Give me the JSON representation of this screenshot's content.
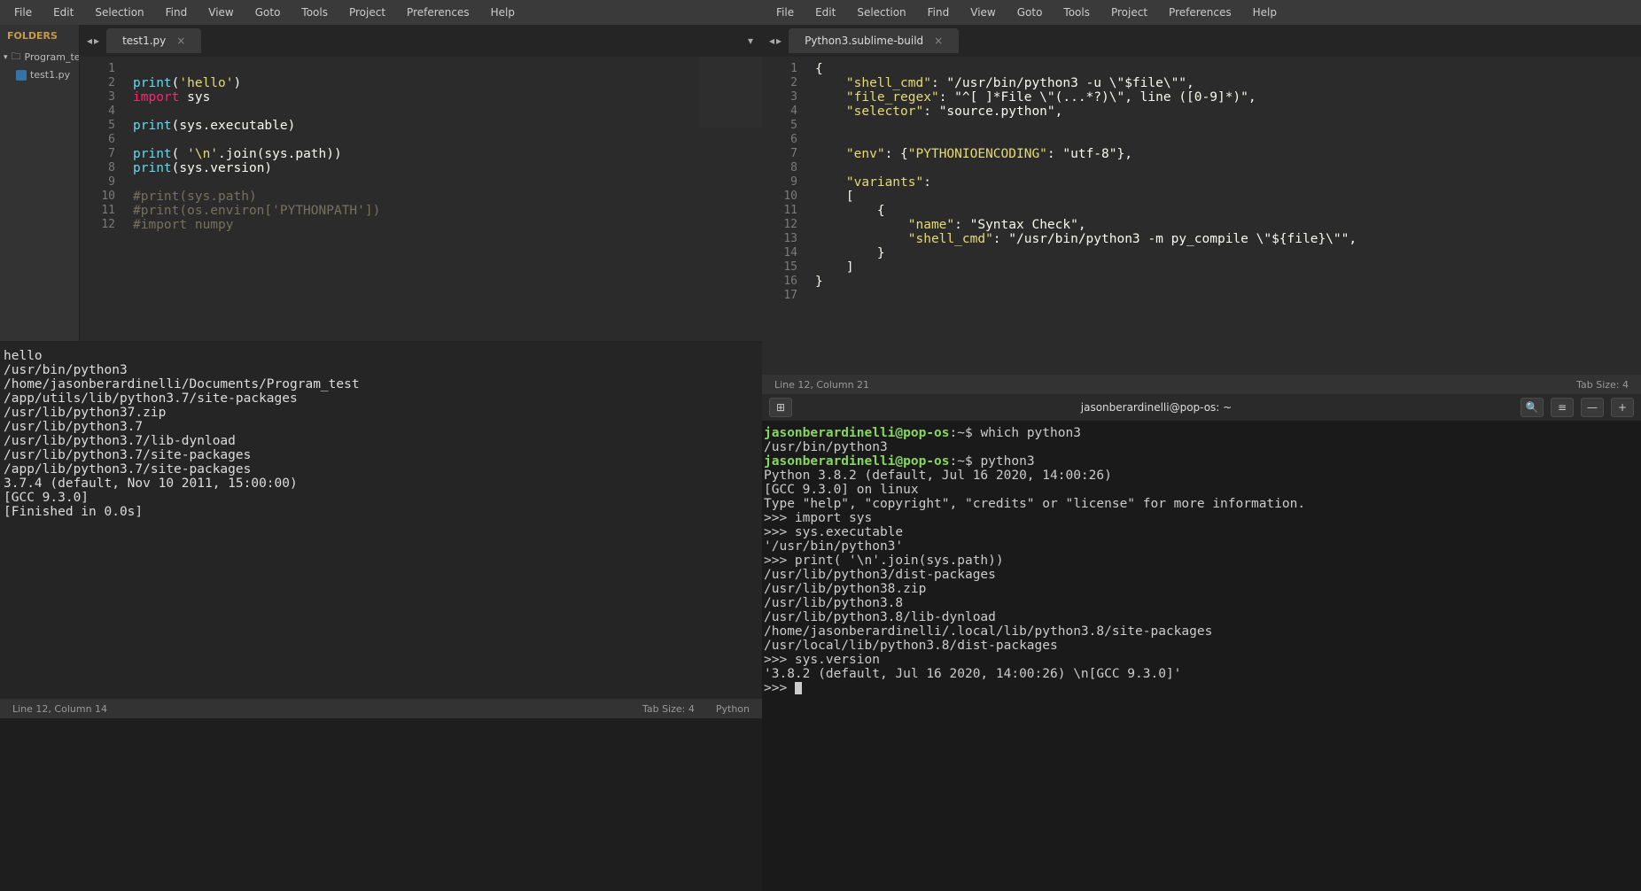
{
  "left": {
    "menubar": [
      "File",
      "Edit",
      "Selection",
      "Find",
      "View",
      "Goto",
      "Tools",
      "Project",
      "Preferences",
      "Help"
    ],
    "sidebar": {
      "title": "FOLDERS",
      "folder": "Program_tes",
      "file": "test1.py"
    },
    "tab": {
      "name": "test1.py"
    },
    "code": {
      "l1": "",
      "l2_fn": "print",
      "l2_p1": "(",
      "l2_str": "'hello'",
      "l2_p2": ")",
      "l3_kw": "import",
      "l3_id": " sys",
      "l4": "",
      "l5_fn": "print",
      "l5_p1": "(",
      "l5_id": "sys.executable",
      "l5_p2": ")",
      "l6": "",
      "l7_fn": "print",
      "l7_p1": "( ",
      "l7_str": "'\\n'",
      "l7_id": ".join(sys.path))",
      "l8_fn": "print",
      "l8_p1": "(",
      "l8_id": "sys.version",
      "l8_p2": ")",
      "l9": "",
      "l10_c": "#print(sys.path)",
      "l11_c": "#print(os.environ['PYTHONPATH'])",
      "l12_c": "#import numpy"
    },
    "build_output": "hello\n/usr/bin/python3\n/home/jasonberardinelli/Documents/Program_test\n/app/utils/lib/python3.7/site-packages\n/usr/lib/python37.zip\n/usr/lib/python3.7\n/usr/lib/python3.7/lib-dynload\n/usr/lib/python3.7/site-packages\n/app/lib/python3.7/site-packages\n3.7.4 (default, Nov 10 2011, 15:00:00) \n[GCC 9.3.0]\n[Finished in 0.0s]",
    "status": {
      "pos": "Line 12, Column 14",
      "tabsize": "Tab Size: 4",
      "syntax": "Python"
    }
  },
  "right": {
    "menubar": [
      "File",
      "Edit",
      "Selection",
      "Find",
      "View",
      "Goto",
      "Tools",
      "Project",
      "Preferences",
      "Help"
    ],
    "tab": {
      "name": "Python3.sublime-build"
    },
    "code_lines": [
      "{",
      "    \"shell_cmd\": \"/usr/bin/python3 -u \\\"$file\\\"\",",
      "    \"file_regex\": \"^[ ]*File \\\"(...*?)\\\", line ([0-9]*)\",",
      "    \"selector\": \"source.python\",",
      "",
      "",
      "    \"env\": {\"PYTHONIOENCODING\": \"utf-8\"},",
      "",
      "    \"variants\":",
      "    [",
      "        {",
      "            \"name\": \"Syntax Check\",",
      "            \"shell_cmd\": \"/usr/bin/python3 -m py_compile \\\"${file}\\\"\",",
      "        }",
      "    ]",
      "}",
      ""
    ],
    "status": {
      "pos": "Line 12, Column 21",
      "tabsize": "Tab Size: 4"
    }
  },
  "terminal": {
    "title": "jasonberardinelli@pop-os: ~",
    "prompt_user": "jasonberardinelli@pop-os",
    "prompt_path": ":~$ ",
    "lines": [
      {
        "type": "cmd",
        "text": "which python3"
      },
      {
        "type": "out",
        "text": "/usr/bin/python3"
      },
      {
        "type": "cmd",
        "text": "python3"
      },
      {
        "type": "out",
        "text": "Python 3.8.2 (default, Jul 16 2020, 14:00:26) "
      },
      {
        "type": "out",
        "text": "[GCC 9.3.0] on linux"
      },
      {
        "type": "out",
        "text": "Type \"help\", \"copyright\", \"credits\" or \"license\" for more information."
      },
      {
        "type": "out",
        "text": ">>> import sys"
      },
      {
        "type": "out",
        "text": ">>> sys.executable"
      },
      {
        "type": "out",
        "text": "'/usr/bin/python3'"
      },
      {
        "type": "out",
        "text": ">>> print( '\\n'.join(sys.path))"
      },
      {
        "type": "out",
        "text": ""
      },
      {
        "type": "out",
        "text": "/usr/lib/python3/dist-packages"
      },
      {
        "type": "out",
        "text": "/usr/lib/python38.zip"
      },
      {
        "type": "out",
        "text": "/usr/lib/python3.8"
      },
      {
        "type": "out",
        "text": "/usr/lib/python3.8/lib-dynload"
      },
      {
        "type": "out",
        "text": "/home/jasonberardinelli/.local/lib/python3.8/site-packages"
      },
      {
        "type": "out",
        "text": "/usr/local/lib/python3.8/dist-packages"
      },
      {
        "type": "out",
        "text": ">>> sys.version"
      },
      {
        "type": "out",
        "text": "'3.8.2 (default, Jul 16 2020, 14:00:26) \\n[GCC 9.3.0]'"
      },
      {
        "type": "out",
        "text": ">>> "
      }
    ]
  }
}
